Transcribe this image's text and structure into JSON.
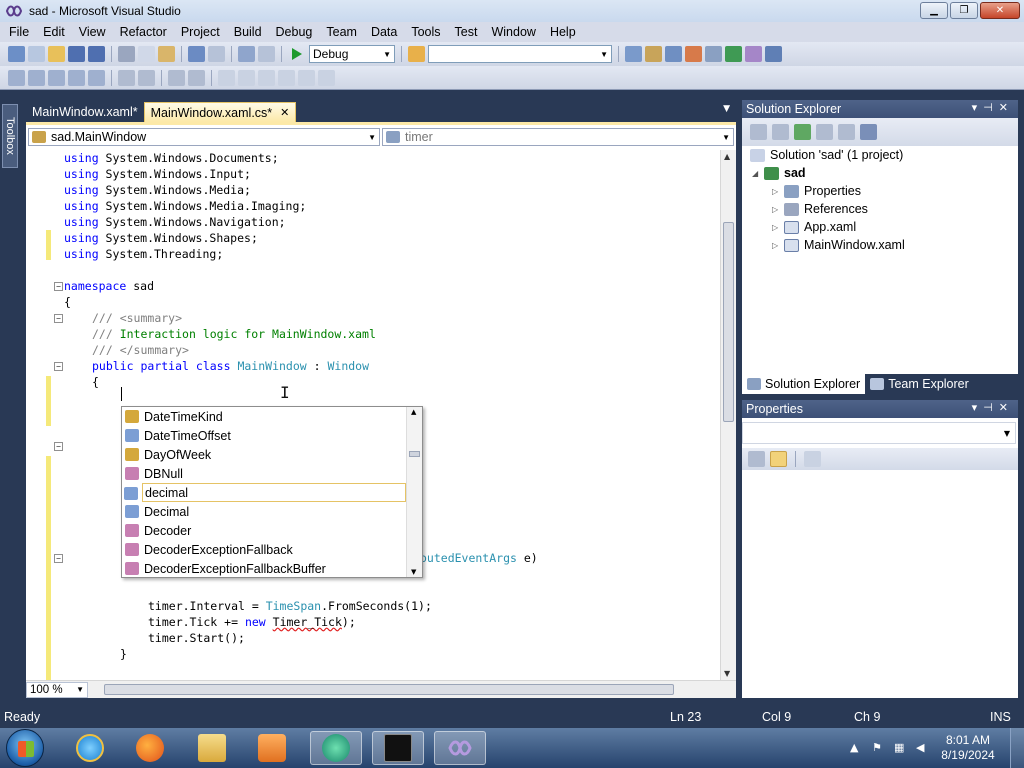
{
  "window": {
    "title": "sad - Microsoft Visual Studio"
  },
  "menu": [
    "File",
    "Edit",
    "View",
    "Refactor",
    "Project",
    "Build",
    "Debug",
    "Team",
    "Data",
    "Tools",
    "Test",
    "Window",
    "Help"
  ],
  "toolbar": {
    "config": "Debug",
    "platform": ""
  },
  "toolbox_tab": "Toolbox",
  "doc_tabs": [
    {
      "label": "MainWindow.xaml*",
      "active": false
    },
    {
      "label": "MainWindow.xaml.cs*",
      "active": true
    }
  ],
  "navbar": {
    "type": "sad.MainWindow",
    "member": "timer"
  },
  "code_lines": {
    "l1": {
      "kw": "using",
      "rest": " System.Windows.Documents;"
    },
    "l2": {
      "kw": "using",
      "rest": " System.Windows.Input;"
    },
    "l3": {
      "kw": "using",
      "rest": " System.Windows.Media;"
    },
    "l4": {
      "kw": "using",
      "rest": " System.Windows.Media.Imaging;"
    },
    "l5": {
      "kw": "using",
      "rest": " System.Windows.Navigation;"
    },
    "l6": {
      "kw": "using",
      "rest": " System.Windows.Shapes;"
    },
    "l7": {
      "kw": "using",
      "rest": " System.Threading;"
    },
    "ns": {
      "kw": "namespace",
      "rest": " sad"
    },
    "brace1": "{",
    "doc1": {
      "slash": "/// ",
      "tag": "<summary>"
    },
    "doc2": {
      "slash": "/// ",
      "text": "Interaction logic for MainWindow.xaml"
    },
    "doc3": {
      "slash": "/// ",
      "tag": "</summary>"
    },
    "cls": {
      "kw1": "public",
      "kw2": "partial",
      "kw3": "class",
      "name": "MainWindow",
      "colon": " : ",
      "base": "Window"
    },
    "brace2": "{",
    "routed": {
      "typ": "outedEventArgs",
      "rest": " e)"
    },
    "t1": {
      "pre": "timer.Interval = ",
      "typ": "TimeSpan",
      "rest": ".FromSeconds(1);"
    },
    "t2": {
      "pre": "timer.Tick += ",
      "kw": "new",
      "sp": " ",
      "squig": "Timer_Tick",
      "rest": ");"
    },
    "t3": "timer.Start();",
    "brace3": "}"
  },
  "intellisense": {
    "items": [
      {
        "label": "DateTimeKind",
        "kind": "enum"
      },
      {
        "label": "DateTimeOffset",
        "kind": "struct"
      },
      {
        "label": "DayOfWeek",
        "kind": "enum"
      },
      {
        "label": "DBNull",
        "kind": "class"
      },
      {
        "label": "decimal",
        "kind": "struct",
        "selected": true
      },
      {
        "label": "Decimal",
        "kind": "struct"
      },
      {
        "label": "Decoder",
        "kind": "class"
      },
      {
        "label": "DecoderExceptionFallback",
        "kind": "class"
      },
      {
        "label": "DecoderExceptionFallbackBuffer",
        "kind": "class"
      }
    ]
  },
  "editor": {
    "zoom": "100 %"
  },
  "solution_explorer": {
    "title": "Solution Explorer",
    "items": [
      {
        "label": "Solution 'sad' (1 project)"
      },
      {
        "label": "sad",
        "bold": true
      },
      {
        "label": "Properties"
      },
      {
        "label": "References"
      },
      {
        "label": "App.xaml"
      },
      {
        "label": "MainWindow.xaml"
      }
    ],
    "tabs": [
      "Solution Explorer",
      "Team Explorer"
    ]
  },
  "properties": {
    "title": "Properties"
  },
  "status": {
    "text": "Ready",
    "ln": "Ln 23",
    "col": "Col 9",
    "ch": "Ch 9",
    "mode": "INS"
  },
  "taskbar": {
    "time": "8:01 AM",
    "date": "8/19/2024"
  },
  "colors": {
    "chrome": "#293955",
    "active_tab": "#fce9a8",
    "keyword": "#0000ff",
    "type": "#2b91af",
    "comment": "#008000"
  }
}
